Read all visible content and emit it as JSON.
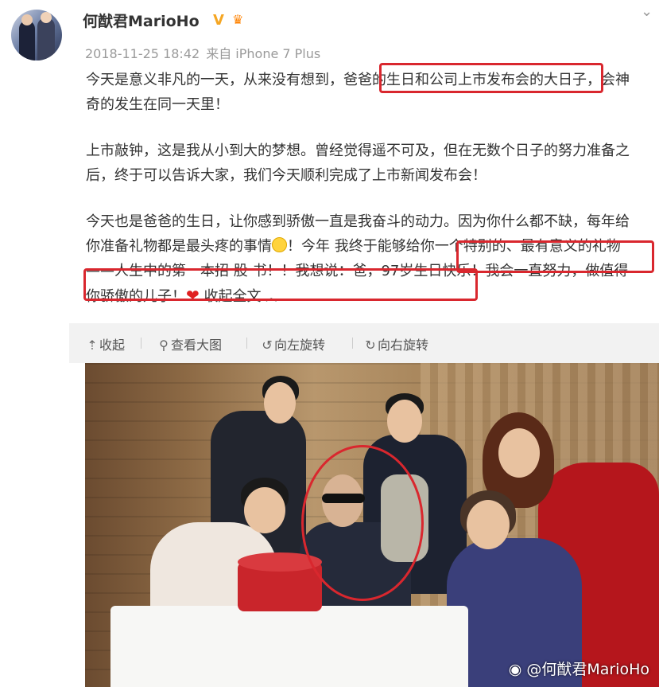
{
  "post": {
    "username": "何猷君MarioHo",
    "verified_badge": "V",
    "timestamp": "2018-11-25 18:42",
    "via_prefix": "来自",
    "device": "iPhone 7 Plus",
    "paragraphs": [
      {
        "text": "今天是意义非凡的一天，从来没有想到，爸爸的生日和公司上市发布会的大日子，会神奇的发生在同一天里！"
      },
      {
        "text": "上市敲钟，这是我从小到大的梦想。曾经觉得遥不可及，但在无数个日子的努力准备之后，终于可以告诉大家，我们今天顺利完成了上市新闻发布会！"
      },
      {
        "text_a": "今天也是爸爸的生日，让你感到骄傲一直是我奋斗的动力。因为你什么都不缺，每年给你准备礼物都是最头疼的事情",
        "text_b": "！今年 我终于能够给你一个特别的、最有意义的礼物——人生中的第一本招 股 书！！我想说：爸，97岁生日快乐！我会一直努力，做值得你骄傲的儿子！",
        "collapse_label": "收起全文"
      }
    ]
  },
  "toolbar": {
    "collapse": "收起",
    "view_large": "查看大图",
    "rotate_left": "向左旋转",
    "rotate_right": "向右旋转"
  },
  "photo": {
    "watermark": "@何猷君MarioHo"
  },
  "colors": {
    "highlight": "#d9272e",
    "badge": "#f5a623",
    "toolbar_bg": "#f2f2f2"
  },
  "icons": [
    "chevron-down-icon",
    "crown-icon",
    "smile-emoji-icon",
    "heart-icon",
    "caret-up-icon",
    "collapse-icon",
    "search-icon",
    "rotate-left-icon",
    "rotate-right-icon",
    "weibo-logo-icon"
  ]
}
